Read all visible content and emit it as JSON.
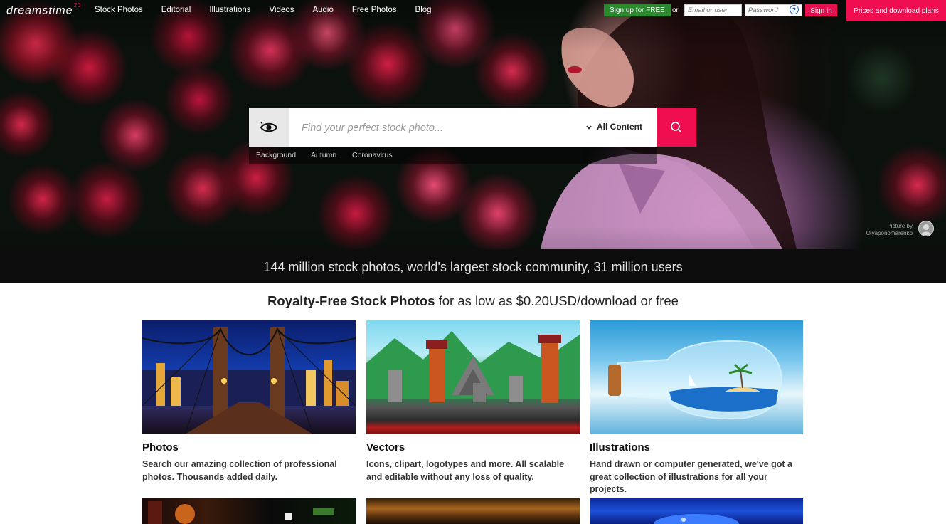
{
  "brand": {
    "logo_text": "dreamstime",
    "logo_badge": "20"
  },
  "nav": {
    "links": [
      "Stock Photos",
      "Editorial",
      "Illustrations",
      "Videos",
      "Audio",
      "Free Photos",
      "Blog"
    ],
    "signup_label": "Sign up for FREE",
    "or_text": "or",
    "email_placeholder": "Email or user",
    "password_placeholder": "Password",
    "help_glyph": "?",
    "signin_label": "Sign in",
    "prices_label": "Prices and download plans"
  },
  "search": {
    "placeholder": "Find your perfect stock photo...",
    "content_filter": "All Content",
    "suggestions": [
      "Background",
      "Autumn",
      "Coronavirus"
    ]
  },
  "hero": {
    "credit_label": "Picture by",
    "credit_author": "Olyaponomarenko",
    "tagline": "144 million stock photos, world's largest stock community, 31 million users"
  },
  "headline": {
    "bold": "Royalty-Free Stock Photos",
    "rest": " for as low as $0.20USD/download or free"
  },
  "cards": [
    {
      "title": "Photos",
      "desc": "Search our amazing collection of professional photos. Thousands added daily."
    },
    {
      "title": "Vectors",
      "desc": "Icons, clipart, logotypes and more. All scalable and editable without any loss of quality."
    },
    {
      "title": "Illustrations",
      "desc": "Hand drawn or computer generated, we've got a great collection of illustrations for all your projects."
    }
  ],
  "colors": {
    "accent": "#ef0e4f",
    "signup_green": "#2a8a2d",
    "help_blue": "#1d5ec0"
  },
  "icons": {
    "eye": "eye-icon",
    "search": "search-icon",
    "chevron": "chevron-down-icon",
    "help": "help-icon"
  }
}
